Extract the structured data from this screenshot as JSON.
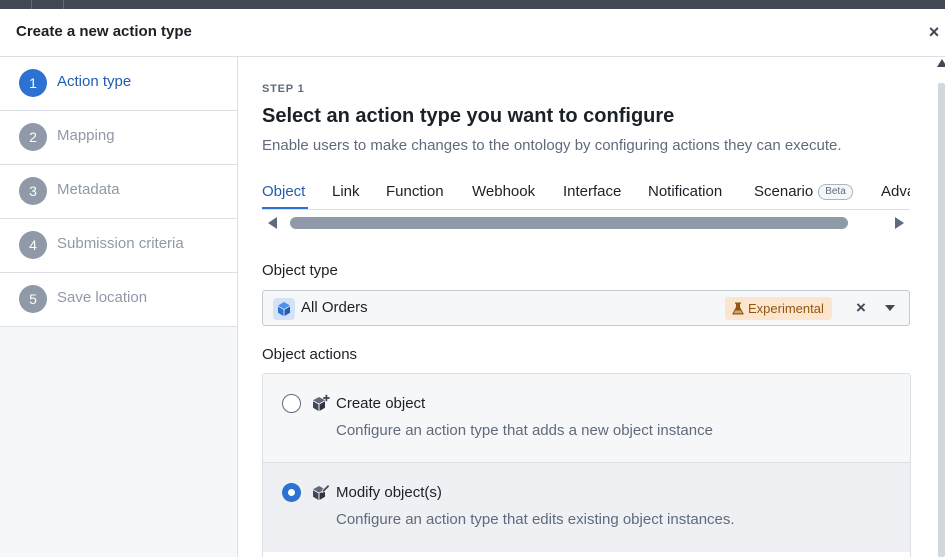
{
  "dialog": {
    "title": "Create a new action type",
    "close_label": "×"
  },
  "steps": [
    {
      "number": "1",
      "label": "Action type",
      "active": true
    },
    {
      "number": "2",
      "label": "Mapping",
      "active": false
    },
    {
      "number": "3",
      "label": "Metadata",
      "active": false
    },
    {
      "number": "4",
      "label": "Submission criteria",
      "active": false
    },
    {
      "number": "5",
      "label": "Save location",
      "active": false
    }
  ],
  "main": {
    "eyebrow": "STEP 1",
    "heading": "Select an action type you want to configure",
    "subheading": "Enable users to make changes to the ontology by configuring actions they can execute.",
    "tabs": [
      {
        "label": "Object",
        "active": true
      },
      {
        "label": "Link"
      },
      {
        "label": "Function"
      },
      {
        "label": "Webhook"
      },
      {
        "label": "Interface"
      },
      {
        "label": "Notification"
      },
      {
        "label": "Scenario",
        "badge": "Beta"
      },
      {
        "label": "Adva"
      }
    ],
    "object_type": {
      "label": "Object type",
      "value": "All Orders",
      "icon": "cube-icon",
      "tag": "Experimental",
      "tag_icon": "flask-icon",
      "clear_label": "×"
    },
    "object_actions": {
      "label": "Object actions",
      "options": [
        {
          "title": "Create object",
          "description": "Configure an action type that adds a new object instance",
          "icon": "cube-plus-icon",
          "selected": false
        },
        {
          "title": "Modify object(s)",
          "description": "Configure an action type that edits existing object instances.",
          "icon": "cube-edit-icon",
          "selected": true
        }
      ]
    }
  },
  "colors": {
    "primary": "#2d72d2",
    "primary_text": "#215db0",
    "muted": "#8f99a8",
    "tag_bg": "#fbe5cf",
    "tag_text": "#935610"
  }
}
